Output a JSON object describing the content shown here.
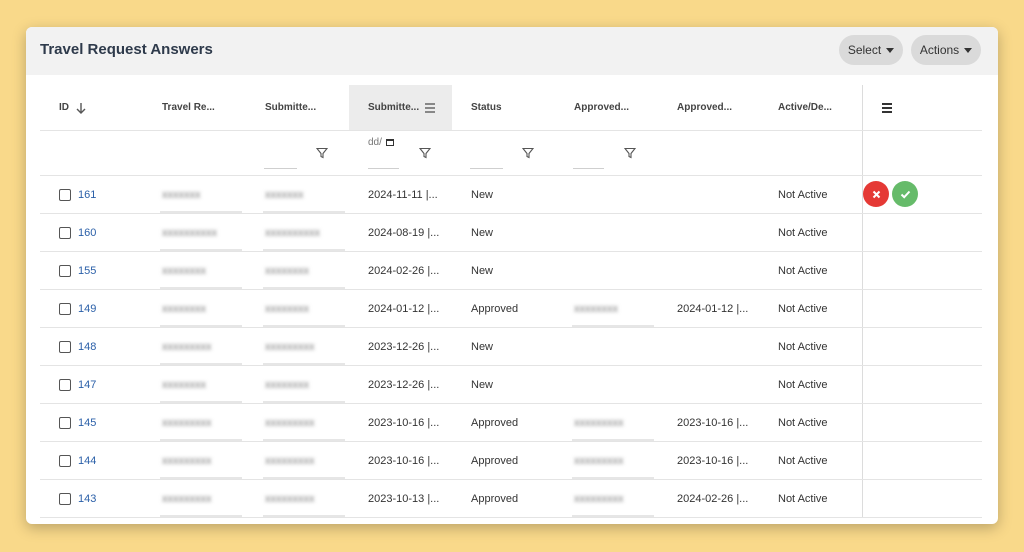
{
  "header": {
    "title": "Travel Request Answers",
    "select_label": "Select",
    "actions_label": "Actions"
  },
  "columns": [
    {
      "label": "ID"
    },
    {
      "label": "Travel Re..."
    },
    {
      "label": "Submitte..."
    },
    {
      "label": "Submitte..."
    },
    {
      "label": "Status"
    },
    {
      "label": "Approved..."
    },
    {
      "label": "Approved..."
    },
    {
      "label": "Active/De..."
    }
  ],
  "filters": {
    "date_placeholder": "dd/"
  },
  "rows": [
    {
      "id": "161",
      "traveler": "xxxxxxx",
      "submitter": "xxxxxxx",
      "submitted": "2024-11-11 |...",
      "status": "New",
      "approver": "",
      "approved": "",
      "active": "Not Active"
    },
    {
      "id": "160",
      "traveler": "xxxxxxxxxx",
      "submitter": "xxxxxxxxxx",
      "submitted": "2024-08-19 |...",
      "status": "New",
      "approver": "",
      "approved": "",
      "active": "Not Active"
    },
    {
      "id": "155",
      "traveler": "xxxxxxxx",
      "submitter": "xxxxxxxx",
      "submitted": "2024-02-26 |...",
      "status": "New",
      "approver": "",
      "approved": "",
      "active": "Not Active"
    },
    {
      "id": "149",
      "traveler": "xxxxxxxx",
      "submitter": "xxxxxxxx",
      "submitted": "2024-01-12 |...",
      "status": "Approved",
      "approver": "xxxxxxxx",
      "approved": "2024-01-12 |...",
      "active": "Not Active"
    },
    {
      "id": "148",
      "traveler": "xxxxxxxxx",
      "submitter": "xxxxxxxxx",
      "submitted": "2023-12-26 |...",
      "status": "New",
      "approver": "",
      "approved": "",
      "active": "Not Active"
    },
    {
      "id": "147",
      "traveler": "xxxxxxxx",
      "submitter": "xxxxxxxx",
      "submitted": "2023-12-26 |...",
      "status": "New",
      "approver": "",
      "approved": "",
      "active": "Not Active"
    },
    {
      "id": "145",
      "traveler": "xxxxxxxxx",
      "submitter": "xxxxxxxxx",
      "submitted": "2023-10-16 |...",
      "status": "Approved",
      "approver": "xxxxxxxxx",
      "approved": "2023-10-16 |...",
      "active": "Not Active"
    },
    {
      "id": "144",
      "traveler": "xxxxxxxxx",
      "submitter": "xxxxxxxxx",
      "submitted": "2023-10-16 |...",
      "status": "Approved",
      "approver": "xxxxxxxxx",
      "approved": "2023-10-16 |...",
      "active": "Not Active"
    },
    {
      "id": "143",
      "traveler": "xxxxxxxxx",
      "submitter": "xxxxxxxxx",
      "submitted": "2023-10-13 |...",
      "status": "Approved",
      "approver": "xxxxxxxxx",
      "approved": "2024-02-26 |...",
      "active": "Not Active"
    }
  ],
  "row_actions": {
    "reject_icon": "close-icon",
    "approve_icon": "check-icon",
    "reject_color": "#e53935",
    "approve_color": "#66bb6a"
  },
  "colors": {
    "background": "#f9d98a",
    "link": "#2a5fa8"
  }
}
